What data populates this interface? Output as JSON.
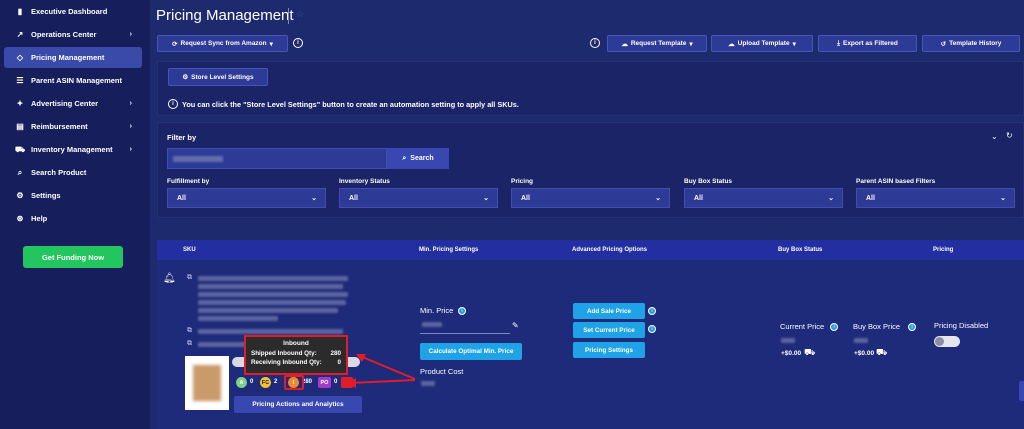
{
  "sidebar": {
    "items": [
      {
        "label": "Executive Dashboard",
        "icon": "bar-chart-icon",
        "chev": ""
      },
      {
        "label": "Operations Center",
        "icon": "trend-up-icon",
        "chev": "›"
      },
      {
        "label": "Pricing Management",
        "icon": "tag-icon",
        "chev": ""
      },
      {
        "label": "Parent ASIN Management",
        "icon": "list-icon",
        "chev": ""
      },
      {
        "label": "Advertising Center",
        "icon": "megaphone-icon",
        "chev": "›"
      },
      {
        "label": "Reimbursement",
        "icon": "receipt-icon",
        "chev": "›"
      },
      {
        "label": "Inventory Management",
        "icon": "truck-icon",
        "chev": "›"
      },
      {
        "label": "Search Product",
        "icon": "search-icon",
        "chev": ""
      },
      {
        "label": "Settings",
        "icon": "gear-icon",
        "chev": ""
      },
      {
        "label": "Help",
        "icon": "help-icon",
        "chev": ""
      }
    ],
    "funding_label": "Get Funding Now"
  },
  "header": {
    "title": "Pricing Management",
    "sync_label": "Request Sync from Amazon",
    "request_template": "Request Template",
    "upload_template": "Upload Template",
    "export_filtered": "Export as Filtered",
    "template_history": "Template History"
  },
  "store": {
    "button_label": "Store Level Settings",
    "note": "You can click the \"Store Level Settings\" button to create an automation setting to apply all SKUs."
  },
  "filter": {
    "label": "Filter by",
    "search_label": "Search",
    "fields": [
      {
        "label": "Fulfillment by",
        "value": "All"
      },
      {
        "label": "Inventory Status",
        "value": "All"
      },
      {
        "label": "Pricing",
        "value": "All"
      },
      {
        "label": "Buy Box Status",
        "value": "All"
      },
      {
        "label": "Parent ASIN based Filters",
        "value": "All"
      }
    ]
  },
  "table": {
    "headers": [
      "SKU",
      "Min. Pricing Settings",
      "Advanced Pricing Options",
      "Buy Box Status",
      "Pricing"
    ]
  },
  "row": {
    "min_price_label": "Min. Price",
    "calc_label": "Calculate Optimal Min. Price",
    "product_cost_label": "Product Cost",
    "add_sale_price": "Add Sale Price",
    "set_current_price": "Set Current Price",
    "pricing_settings": "Pricing Settings",
    "current_price_label": "Current Price",
    "buy_box_price_label": "Buy Box Price",
    "current_delta": "+$0.00",
    "buybox_delta": "+$0.00",
    "pricing_disabled": "Pricing Disabled",
    "pricing_actions": "Pricing Actions and Analytics",
    "pills": [
      {
        "letter": "A",
        "value": "0",
        "color": "#7ed08a"
      },
      {
        "letter": "FC",
        "value": "2",
        "color": "#f2c230"
      },
      {
        "letter": "I",
        "value": "280",
        "color": "#f08a2a"
      },
      {
        "letter": "PO",
        "value": "0",
        "color": "#a23cc8"
      }
    ]
  },
  "tooltip": {
    "title": "Inbound",
    "shipped_label": "Shipped Inbound Qty:",
    "shipped_value": "280",
    "receiving_label": "Receiving Inbound Qty:",
    "receiving_value": "0"
  },
  "colors": {
    "background": "#1e2a6e",
    "sidebar": "#161f5c",
    "accent_green": "#22c55e",
    "accent_cyan": "#1fa3e6",
    "annotation_red": "#e11d2a"
  }
}
